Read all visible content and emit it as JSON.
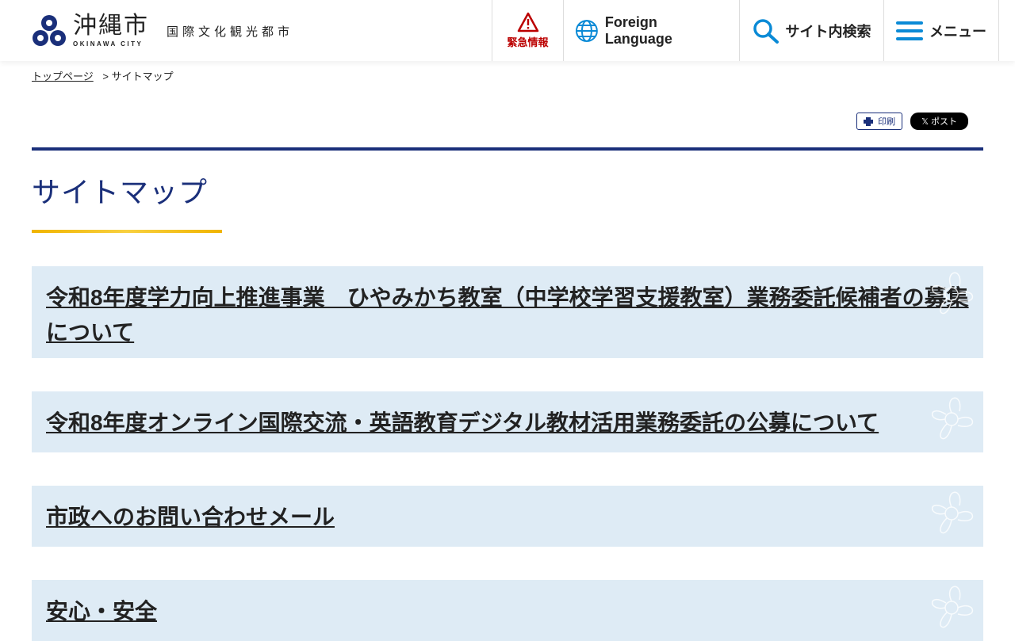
{
  "header": {
    "logo_jp": "沖縄市",
    "logo_en": "OKINAWA CITY",
    "tagline": "国際文化観光都市",
    "emergency": "緊急情報",
    "foreign": "Foreign Language",
    "search": "サイト内検索",
    "menu": "メニュー"
  },
  "breadcrumb": {
    "home": "トップページ",
    "sep": ">",
    "current": "サイトマップ"
  },
  "tools": {
    "print": "印刷",
    "post": "ポスト"
  },
  "page_title": "サイトマップ",
  "items": [
    {
      "label": "令和8年度学力向上推進事業　ひやみかち教室（中学校学習支援教室）業務委託候補者の募集について"
    },
    {
      "label": "令和8年度オンライン国際交流・英語教育デジタル教材活用業務委託の公募について"
    },
    {
      "label": "市政へのお問い合わせメール"
    },
    {
      "label": "安心・安全"
    }
  ]
}
